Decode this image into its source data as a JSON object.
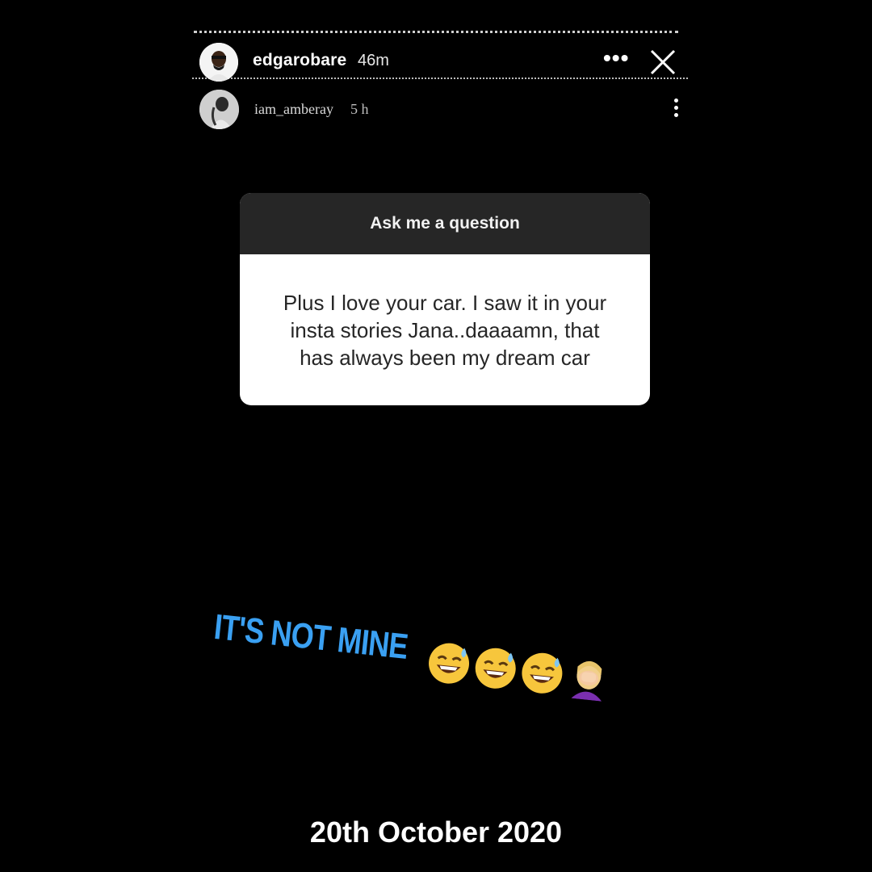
{
  "story": {
    "username": "edgarobare",
    "time": "46m",
    "more_label": "•••"
  },
  "shared_post": {
    "username": "iam_amberay",
    "time": "5 h"
  },
  "question_sticker": {
    "header": "Ask me a question",
    "lines": [
      "Plus I love your car. I saw it in your",
      "insta stories Jana..daaaamn, that",
      "has always been my dream car"
    ]
  },
  "reply": {
    "text": "IT'S NOT MINE",
    "color": "#3aa0f2",
    "emojis": [
      "sweat-smile-emoji",
      "sweat-smile-emoji",
      "sweat-smile-emoji",
      "facepalm-emoji"
    ]
  },
  "caption": {
    "date": "20th October 2020"
  }
}
